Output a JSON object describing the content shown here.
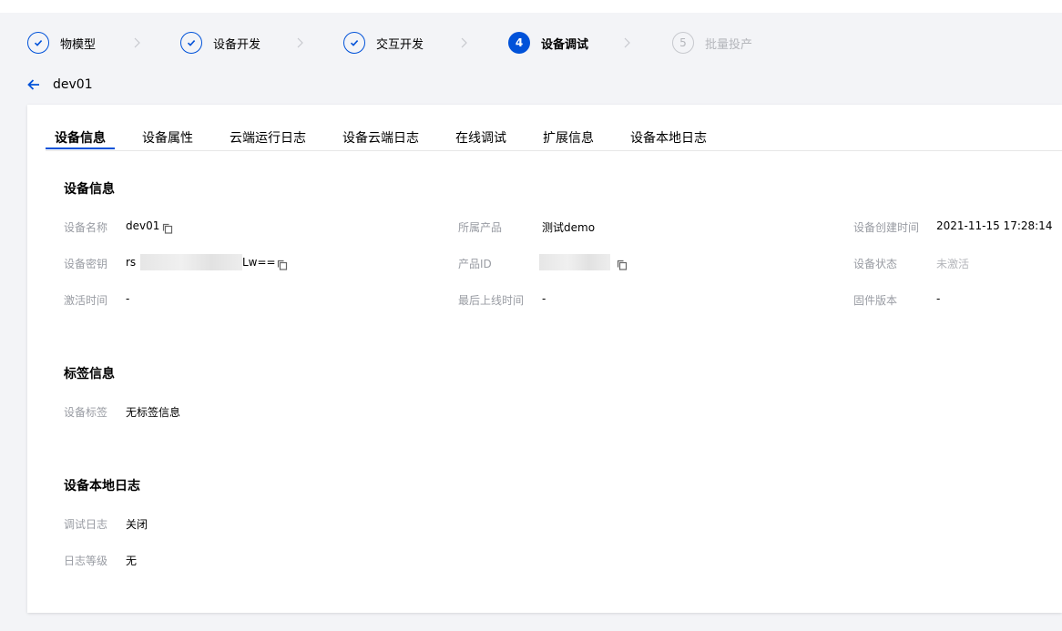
{
  "steps": [
    {
      "label": "物模型",
      "state": "done"
    },
    {
      "label": "设备开发",
      "state": "done"
    },
    {
      "label": "交互开发",
      "state": "done"
    },
    {
      "label": "设备调试",
      "state": "active",
      "number": "4"
    },
    {
      "label": "批量投产",
      "state": "pending",
      "number": "5"
    }
  ],
  "device_name_title": "dev01",
  "tabs": [
    "设备信息",
    "设备属性",
    "云端运行日志",
    "设备云端日志",
    "在线调试",
    "扩展信息",
    "设备本地日志"
  ],
  "device_info": {
    "title": "设备信息",
    "name_label": "设备名称",
    "name_value": "dev01",
    "product_label": "所属产品",
    "product_value": "测试demo",
    "created_label": "设备创建时间",
    "created_value": "2021-11-15 17:28:14",
    "secret_label": "设备密钥",
    "secret_prefix": "rs",
    "secret_suffix": "Lw==",
    "product_id_label": "产品ID",
    "status_label": "设备状态",
    "status_value": "未激活",
    "activation_label": "激活时间",
    "activation_value": "-",
    "last_online_label": "最后上线时间",
    "last_online_value": "-",
    "firmware_label": "固件版本",
    "firmware_value": "-"
  },
  "tag_info": {
    "title": "标签信息",
    "tag_label": "设备标签",
    "tag_value": "无标签信息"
  },
  "local_log": {
    "title": "设备本地日志",
    "debug_label": "调试日志",
    "debug_value": "关闭",
    "level_label": "日志等级",
    "level_value": "无"
  },
  "colors": {
    "primary": "#0052d9",
    "label_gray": "#999ca3",
    "background": "#f3f4f7"
  }
}
